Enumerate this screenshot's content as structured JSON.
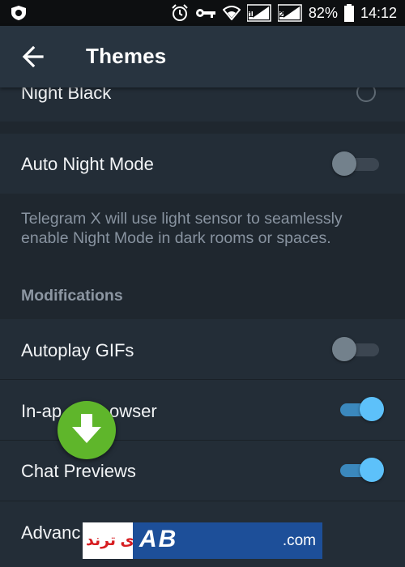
{
  "statusbar": {
    "battery": "82%",
    "time": "14:12",
    "icons": [
      "vpn-shield-icon",
      "alarm-clock-icon",
      "key-icon",
      "wifi-icon",
      "signal-sim1-icon",
      "signal-sim2-icon",
      "battery-icon"
    ],
    "sim1": "1",
    "sim2": "2"
  },
  "appbar": {
    "title": "Themes",
    "back_icon": "arrow-left-icon"
  },
  "rows": {
    "night_black": {
      "label": "Night Black",
      "selected": false
    },
    "auto_night": {
      "label": "Auto Night Mode",
      "enabled": false
    },
    "autoplay_gifs": {
      "label": "Autoplay GIFs",
      "enabled": false
    },
    "in_app_browser": {
      "label": "In-app Browser",
      "visible_label": "In-ap",
      "visible_label_tail": "owser",
      "enabled": true
    },
    "chat_previews": {
      "label": "Chat Previews",
      "enabled": true
    },
    "advanced": {
      "label": "Advanc"
    }
  },
  "helper_text": "Telegram X will use light sensor to seamlessly enable Night Mode in dark rooms or spaces.",
  "section_header": "Modifications",
  "overlay": {
    "fab_icon": "download-arrow-icon",
    "watermark_fa": "آی ترند",
    "watermark_text": "AB",
    "watermark_domain": ".com"
  },
  "colors": {
    "accent": "#5dc1fa",
    "background": "#1f272f",
    "appbar": "#283440",
    "row": "#232d37",
    "fab": "#5fb62b"
  }
}
